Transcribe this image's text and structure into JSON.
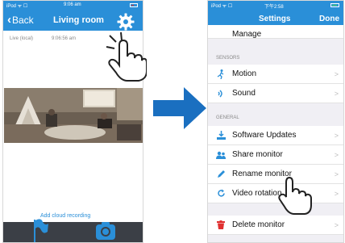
{
  "left_screen": {
    "status": {
      "carrier": "iPod ᯤ ☐",
      "time": "9:06 am"
    },
    "nav": {
      "back_label": "Back",
      "title": "Living room"
    },
    "live": {
      "label": "Live (local)",
      "time": "9:06:56 am"
    },
    "cloud_recording_label": "Add cloud recording"
  },
  "right_screen": {
    "status": {
      "carrier": "iPod ᯤ ☐",
      "time": "下午2:58"
    },
    "nav": {
      "title": "Settings",
      "done_label": "Done"
    },
    "partial_row_label": "Manage",
    "sections": {
      "sensors": "SENSORS",
      "general": "GENERAL"
    },
    "sensors_items": [
      {
        "label": "Motion",
        "icon": "motion-icon"
      },
      {
        "label": "Sound",
        "icon": "sound-icon"
      }
    ],
    "general_items": [
      {
        "label": "Software Updates",
        "icon": "download-icon"
      },
      {
        "label": "Share monitor",
        "icon": "users-icon"
      },
      {
        "label": "Rename monitor",
        "icon": "pencil-icon"
      },
      {
        "label": "Video rotation",
        "icon": "rotate-icon"
      }
    ],
    "delete_label": "Delete monitor",
    "chevron": ">"
  },
  "colors": {
    "accent": "#2a8fd8",
    "arrow": "#1a6fc0",
    "bottom_bar": "#3b3f46",
    "delete_icon": "#e03030"
  }
}
